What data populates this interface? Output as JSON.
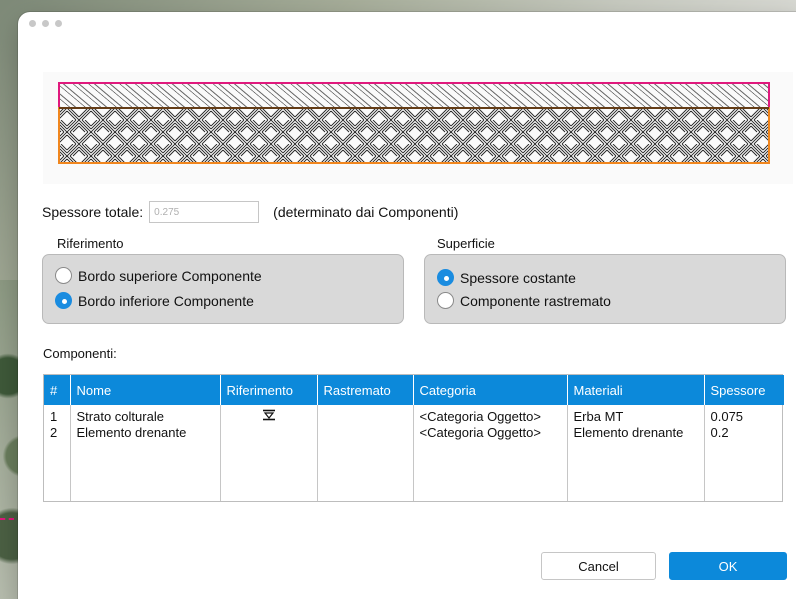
{
  "total": {
    "label": "Spessore totale:",
    "value": "0.275",
    "note": "(determinato dai Componenti)"
  },
  "reference": {
    "title": "Riferimento",
    "options": [
      {
        "label": "Bordo superiore Componente",
        "selected": false
      },
      {
        "label": "Bordo inferiore Componente",
        "selected": true
      }
    ]
  },
  "surface": {
    "title": "Superficie",
    "options": [
      {
        "label": "Spessore costante",
        "selected": true
      },
      {
        "label": "Componente rastremato",
        "selected": false
      }
    ]
  },
  "components": {
    "title": "Componenti:",
    "columns": [
      "#",
      "Nome",
      "Riferimento",
      "Rastremato",
      "Categoria",
      "Materiali",
      "Spessore"
    ],
    "rows": [
      {
        "index": "1",
        "name": "Strato colturale",
        "reference_icon": "reference-top-icon",
        "tapered": "",
        "category": "<Categoria Oggetto>",
        "material": "Erba MT",
        "thickness": "0.075"
      },
      {
        "index": "2",
        "name": "Elemento drenante",
        "reference_icon": "",
        "tapered": "",
        "category": "<Categoria Oggetto>",
        "material": "Elemento drenante",
        "thickness": "0.2"
      }
    ]
  },
  "buttons": {
    "cancel": "Cancel",
    "ok": "OK"
  },
  "colors": {
    "accent": "#0c89da",
    "layer_top_outline": "#e0197d",
    "layer_bottom_outline": "#f0861e"
  }
}
